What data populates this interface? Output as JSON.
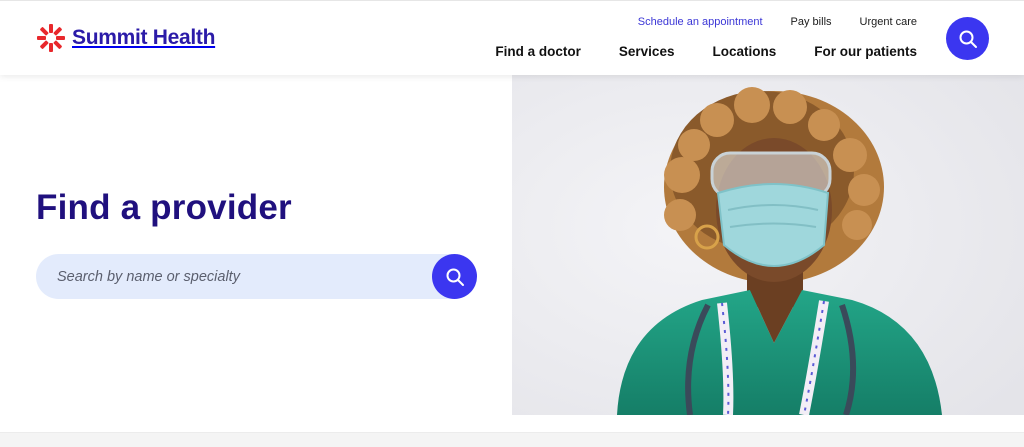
{
  "brand": {
    "name": "Summit Health",
    "color": "#2b1ba8",
    "logo_mark_color": "#e8282c"
  },
  "utility_nav": [
    {
      "label": "Schedule an appointment"
    },
    {
      "label": "Pay bills"
    },
    {
      "label": "Urgent care"
    }
  ],
  "main_nav": [
    {
      "label": "Find a doctor"
    },
    {
      "label": "Services"
    },
    {
      "label": "Locations"
    },
    {
      "label": "For our patients"
    }
  ],
  "header_search": {
    "icon": "search-icon"
  },
  "hero": {
    "title": "Find a provider",
    "search": {
      "placeholder": "Search by name or specialty",
      "value": "",
      "button_icon": "search-icon"
    },
    "photo_icon": "provider-photo"
  },
  "colors": {
    "accent": "#3b36f0",
    "title": "#20107e",
    "search_bg": "#e3ebfc",
    "scrub_green": "#1c9a7f"
  }
}
